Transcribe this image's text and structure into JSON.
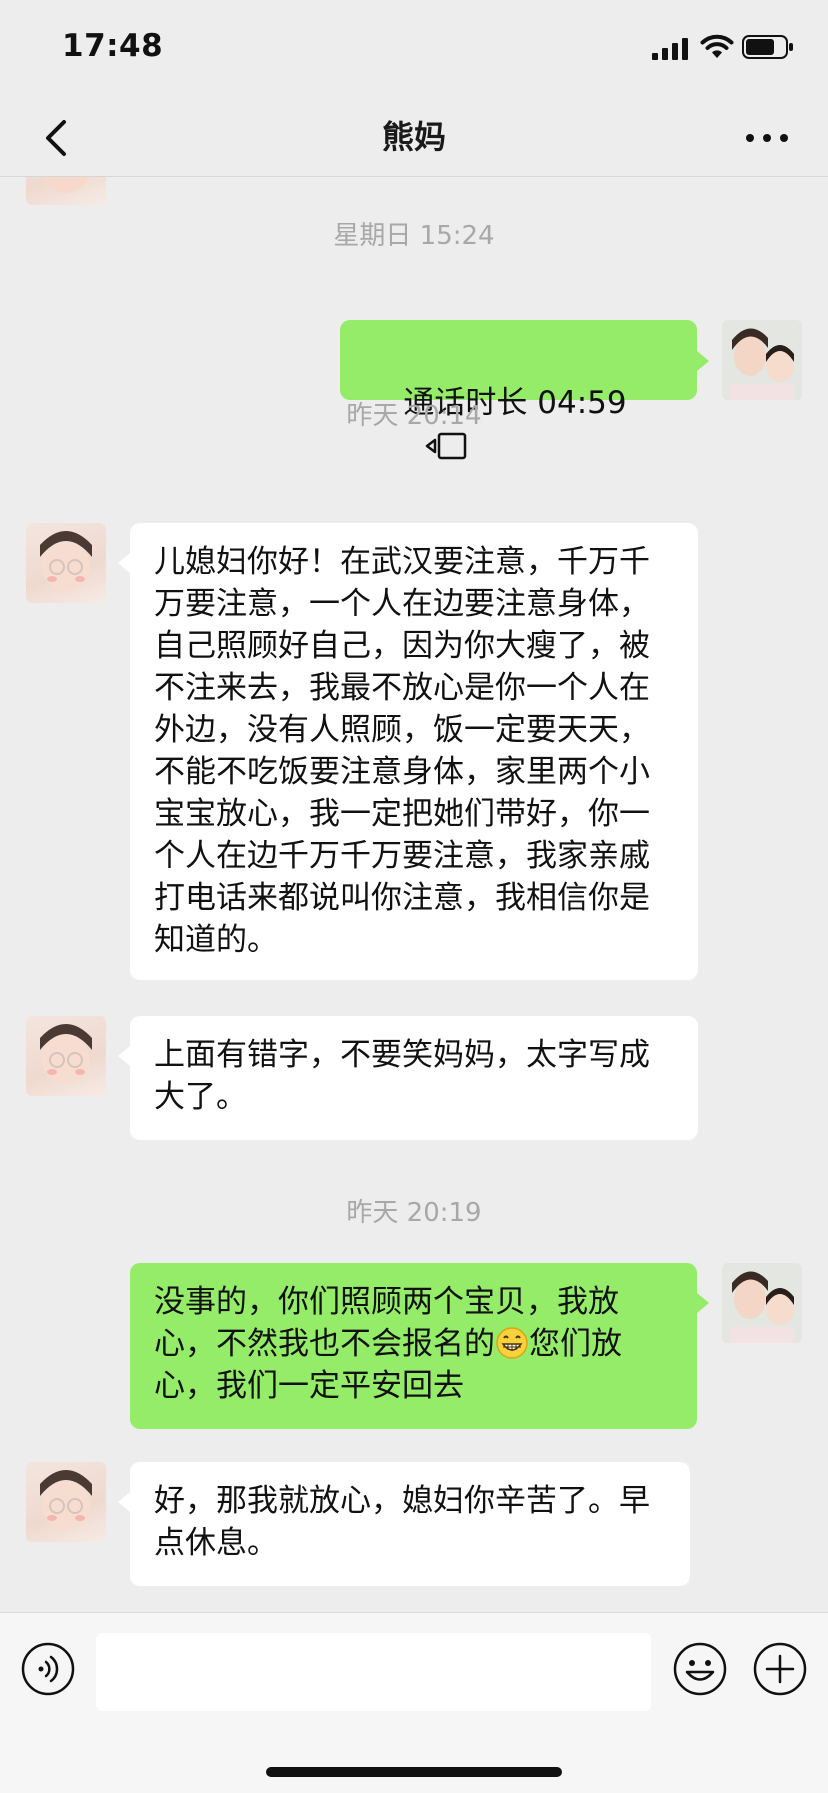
{
  "status_bar": {
    "time": "17:48"
  },
  "header": {
    "title": "熊妈"
  },
  "messages": {
    "partial_top": {
      "from": "contact"
    },
    "ts1": "星期日 15:24",
    "call": {
      "from": "me",
      "text": "通话时长 04:59",
      "icon": "video-call-icon"
    },
    "ts2": "昨天 20:14",
    "msg1": {
      "from": "contact",
      "text": "儿媳妇你好！在武汉要注意，千万千万要注意，一个人在边要注意身体，自己照顾好自己，因为你大瘦了，被不注来去，我最不放心是你一个人在外边，没有人照顾，饭一定要天天，不能不吃饭要注意身体，家里两个小宝宝放心，我一定把她们带好，你一个人在边千万千万要注意，我家亲戚打电话来都说叫你注意，我相信你是知道的。"
    },
    "msg2": {
      "from": "contact",
      "text": "上面有错字，不要笑妈妈，太字写成大了。"
    },
    "ts3": "昨天 20:19",
    "msg3": {
      "from": "me",
      "text_before": "没事的，你们照顾两个宝贝，我放心，不然我也不会报名的",
      "emoji": "grinning-face-emoji",
      "text_after": "您们放心，我们一定平安回去"
    },
    "msg4": {
      "from": "contact",
      "text": "好，那我就放心，媳妇你辛苦了。早点休息。"
    }
  },
  "input_bar": {
    "value": "",
    "icons": [
      "voice-icon",
      "emoji-icon",
      "plus-icon"
    ]
  },
  "colors": {
    "background": "#ededed",
    "outgoing_bubble": "#95ec69",
    "incoming_bubble": "#ffffff",
    "timestamp": "#a8a8a8"
  }
}
